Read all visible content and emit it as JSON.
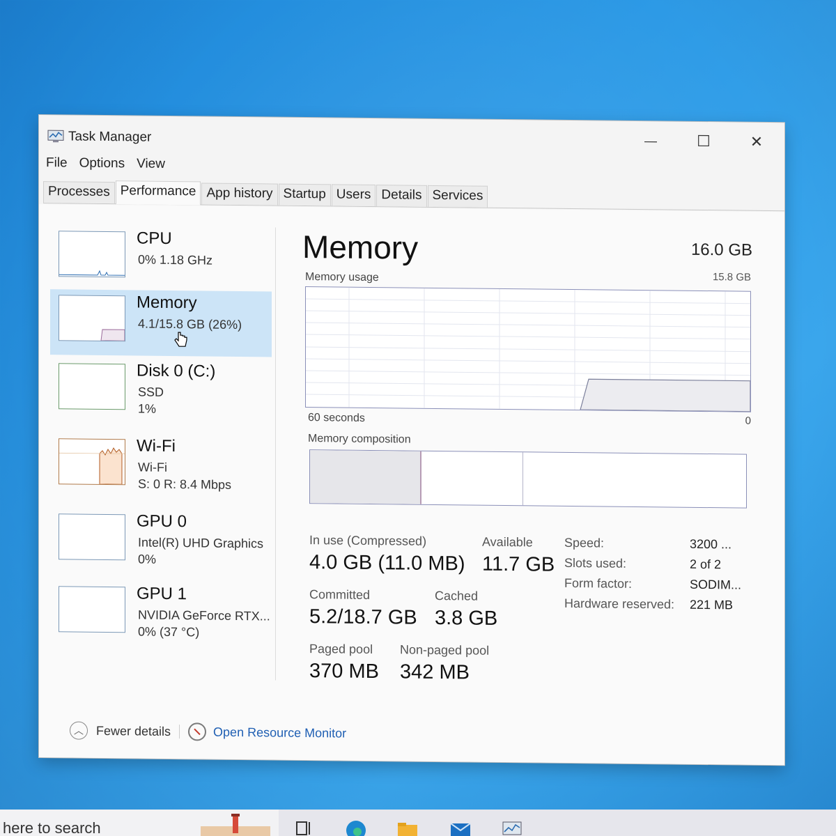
{
  "window": {
    "title": "Task Manager",
    "controls": {
      "minimize": "—",
      "maximize": "☐",
      "close": "✕"
    }
  },
  "menu": [
    "File",
    "Options",
    "View"
  ],
  "tabs": [
    "Processes",
    "Performance",
    "App history",
    "Startup",
    "Users",
    "Details",
    "Services"
  ],
  "active_tab": "Performance",
  "sidebar": [
    {
      "title": "CPU",
      "line1": "0% 1.18 GHz",
      "line2": ""
    },
    {
      "title": "Memory",
      "line1": "4.1/15.8 GB (26%)",
      "line2": ""
    },
    {
      "title": "Disk 0 (C:)",
      "line1": "SSD",
      "line2": "1%"
    },
    {
      "title": "Wi-Fi",
      "line1": "Wi-Fi",
      "line2": "S: 0 R: 8.4 Mbps"
    },
    {
      "title": "GPU 0",
      "line1": "Intel(R) UHD Graphics",
      "line2": "0%"
    },
    {
      "title": "GPU 1",
      "line1": "NVIDIA GeForce RTX...",
      "line2": "0% (37 °C)"
    }
  ],
  "selected_sidebar": "Memory",
  "memory": {
    "title": "Memory",
    "total": "16.0 GB",
    "usage_label": "Memory usage",
    "usage_max": "15.8 GB",
    "time_left": "60 seconds",
    "time_right": "0",
    "composition_label": "Memory composition",
    "stats": {
      "in_use_label": "In use (Compressed)",
      "in_use_value": "4.0 GB (11.0 MB)",
      "available_label": "Available",
      "available_value": "11.7 GB",
      "committed_label": "Committed",
      "committed_value": "5.2/18.7 GB",
      "cached_label": "Cached",
      "cached_value": "3.8 GB",
      "paged_label": "Paged pool",
      "paged_value": "370 MB",
      "nonpaged_label": "Non-paged pool",
      "nonpaged_value": "342 MB"
    },
    "props": [
      {
        "label": "Speed:",
        "value": "3200 ..."
      },
      {
        "label": "Slots used:",
        "value": "2 of 2"
      },
      {
        "label": "Form factor:",
        "value": "SODIM..."
      },
      {
        "label": "Hardware reserved:",
        "value": "221 MB"
      }
    ]
  },
  "footer": {
    "fewer_details": "Fewer details",
    "open_resource_monitor": "Open Resource Monitor"
  },
  "taskbar": {
    "search_text": "here to search"
  },
  "colors": {
    "desktop": "#2d9ae6",
    "selection": "#cce4f7",
    "graph_border": "#8a8fb8",
    "link": "#1f5fb3"
  }
}
